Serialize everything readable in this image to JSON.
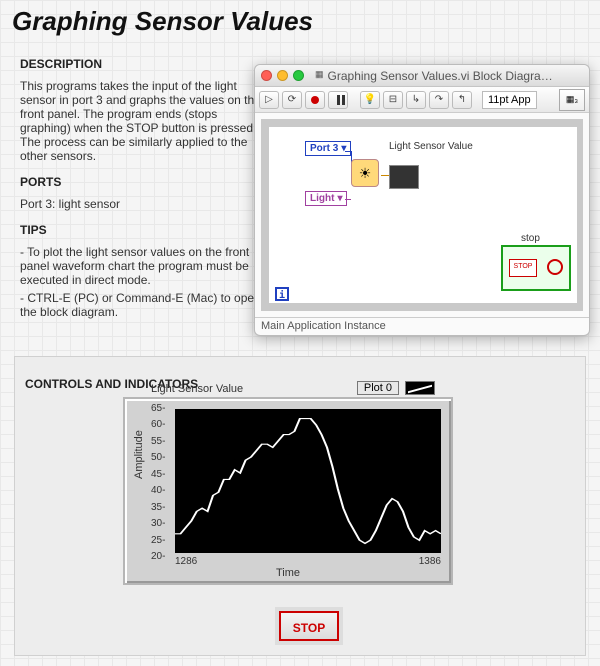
{
  "page": {
    "title": "Graphing Sensor Values",
    "descHeader": "DESCRIPTION",
    "descText": "This programs takes the input of the light sensor in port 3 and graphs the values on the front panel.  The program ends (stops graphing) when the STOP button is pressed.  The process can be similarly applied to the other sensors.",
    "portsHeader": "PORTS",
    "portsText": "Port 3: light sensor",
    "tipsHeader": "TIPS",
    "tips1": "- To plot the light sensor values on the front panel waveform chart the program must be executed in direct mode.",
    "tips2": "- CTRL-E (PC) or Command-E (Mac) to open the block diagram.",
    "controlsHeader": "CONTROLS AND INDICATORS"
  },
  "window": {
    "title": "Graphing Sensor Values.vi Block Diagra…",
    "fontLabel": "11pt App",
    "statusbar": "Main Application Instance",
    "nodes": {
      "port": "Port 3",
      "light": "Light",
      "sensorLabel": "Light Sensor Value",
      "stopLabel": "stop",
      "stopBtn": "STOP",
      "i": "i"
    }
  },
  "chart_data": {
    "type": "line",
    "title": "Light Sensor Value",
    "legend": "Plot 0",
    "xlabel": "Time",
    "ylabel": "Amplitude",
    "xlim": [
      1286,
      1386
    ],
    "ylim": [
      20,
      65
    ],
    "yticks": [
      20,
      25,
      30,
      35,
      40,
      45,
      50,
      55,
      60,
      65
    ],
    "xticks": [
      1286,
      1386
    ],
    "values": [
      26,
      26,
      28,
      30,
      33,
      34,
      33,
      38,
      39,
      43,
      43,
      46,
      45,
      49,
      50,
      52,
      54,
      54,
      53,
      55,
      57,
      57,
      58,
      62,
      62,
      62,
      60,
      57,
      53,
      47,
      40,
      34,
      30,
      27,
      24,
      23,
      24,
      27,
      31,
      35,
      37,
      36,
      33,
      28,
      25,
      24,
      27,
      26,
      27,
      26
    ]
  },
  "frontpanel": {
    "stopLabel": "STOP"
  }
}
